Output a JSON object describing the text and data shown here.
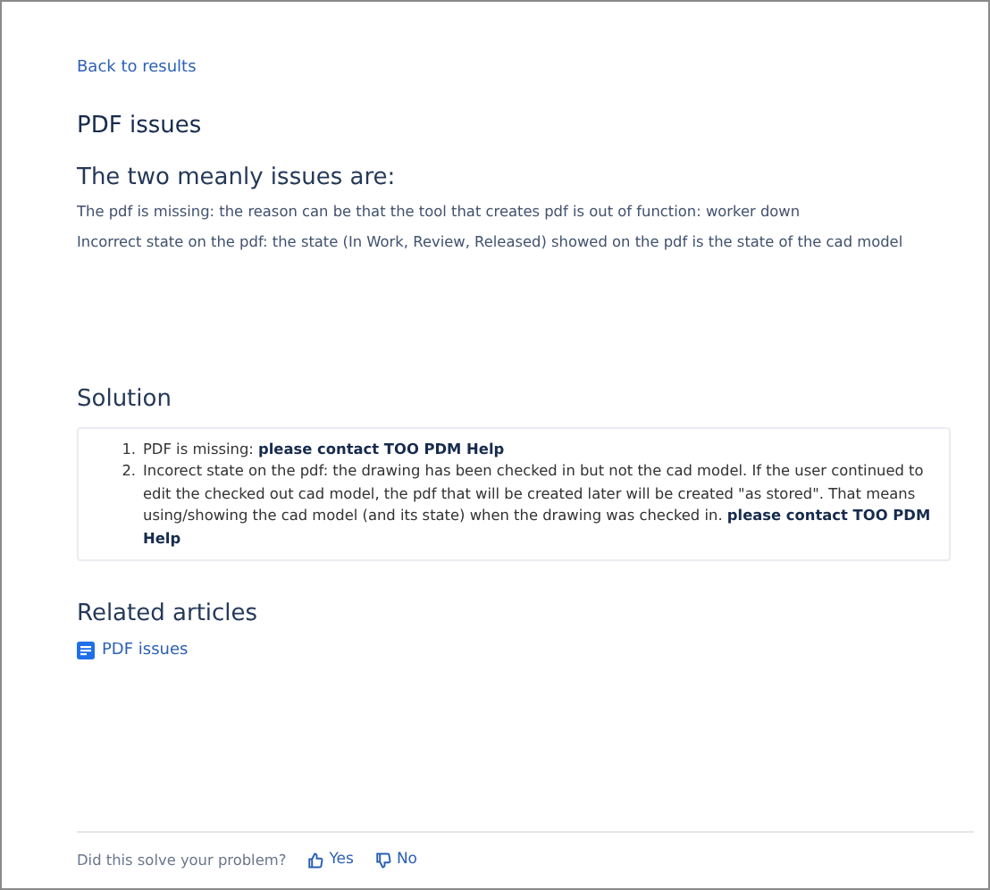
{
  "back_link": "Back to results",
  "title": "PDF issues",
  "intro": {
    "heading": "The two meanly issues are:",
    "paragraphs": [
      "The pdf is missing: the reason can be that the tool that creates pdf is out of function: worker down",
      "Incorrect state on the pdf: the state (In Work, Review, Released) showed on the pdf is the state of the cad model"
    ]
  },
  "solution": {
    "heading": "Solution",
    "items": [
      {
        "number": "1.",
        "text": "PDF is missing: **please contact TOO PDM Help**"
      },
      {
        "number": "2.",
        "text": "Incorect state on the pdf: the drawing has been checked in but not the cad model. If the user continued to edit the checked out cad model, the pdf that will be created later will be created \"as stored\". That means using/showing the cad model (and its state) when the drawing was checked in. **please contact TOO PDM Help**"
      }
    ]
  },
  "related": {
    "heading": "Related articles",
    "articles": [
      {
        "label": "PDF issues"
      }
    ]
  },
  "feedback": {
    "question": "Did this solve your problem?",
    "yes": "Yes",
    "no": "No"
  }
}
